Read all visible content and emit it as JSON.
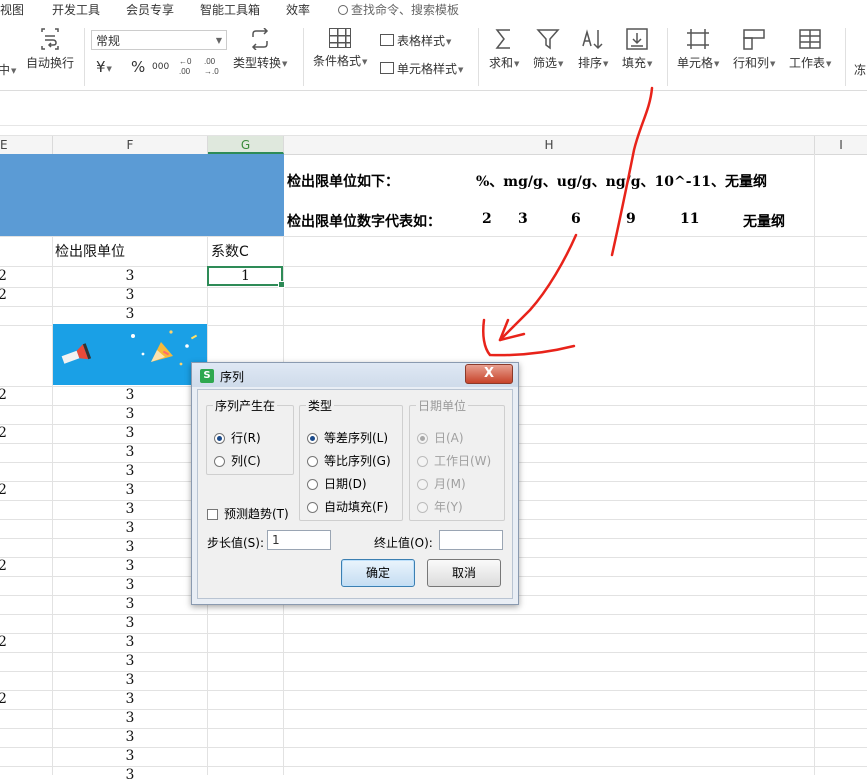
{
  "menubar": {
    "items": [
      "视图",
      "开发工具",
      "会员专享",
      "智能工具箱",
      "效率"
    ],
    "search": "查找命令、搜索模板"
  },
  "ribbon": {
    "wrap_partial": "中",
    "wrap_text": "自动换行",
    "number_format": "常规",
    "currency_symbol": "¥",
    "percent_symbol": "%",
    "thousands_symbol": "000",
    "type_convert": "类型转换",
    "cond_format": "条件格式",
    "table_style": "表格样式",
    "cell_style": "单元格样式",
    "sum": "求和",
    "filter": "筛选",
    "sort": "排序",
    "fill": "填充",
    "cell": "单元格",
    "row_col": "行和列",
    "worksheet": "工作表",
    "freeze_partial": "冻"
  },
  "columns": {
    "e": "E",
    "f": "F",
    "g": "G",
    "h": "H",
    "i": "I"
  },
  "header": {
    "units_line": "检出限单位如下：",
    "units_list": "%、mg/g、ug/g、ng/g、10^-11、无量纲",
    "codes_line": "检出限单位数字代表如：",
    "codes": [
      "2",
      "3",
      "6",
      "9",
      "11",
      "无量纲"
    ]
  },
  "table": {
    "col_f_header": "检出限单位",
    "col_g_header": "系数C",
    "active_value": "1",
    "e_values": [
      "2",
      "2",
      "2",
      "2",
      "2",
      "2",
      "2",
      "2"
    ],
    "f_values": [
      "3",
      "3",
      "3",
      "3",
      "3",
      "3",
      "3",
      "3",
      "3",
      "3",
      "3",
      "3",
      "3",
      "3",
      "3",
      "3",
      "3",
      "3",
      "3",
      "3",
      "3",
      "3",
      "3",
      "3",
      "3",
      "3",
      "3",
      "3",
      "3"
    ]
  },
  "dialog": {
    "title": "序列",
    "close": "X",
    "group_series_in": "序列产生在",
    "opt_row": "行(R)",
    "opt_col": "列(C)",
    "group_type": "类型",
    "opt_linear": "等差序列(L)",
    "opt_growth": "等比序列(G)",
    "opt_date": "日期(D)",
    "opt_autofill": "自动填充(F)",
    "group_date_unit": "日期单位",
    "opt_day": "日(A)",
    "opt_weekday": "工作日(W)",
    "opt_month": "月(M)",
    "opt_year": "年(Y)",
    "trend": "预测趋势(T)",
    "step_label": "步长值(S):",
    "step_value": "1",
    "stop_label": "终止值(O):",
    "stop_value": "",
    "ok": "确定",
    "cancel": "取消"
  },
  "colors": {
    "accent_green": "#2e8b57",
    "blue_fill": "#5b9bd5",
    "annotation_red": "#e8231a"
  }
}
